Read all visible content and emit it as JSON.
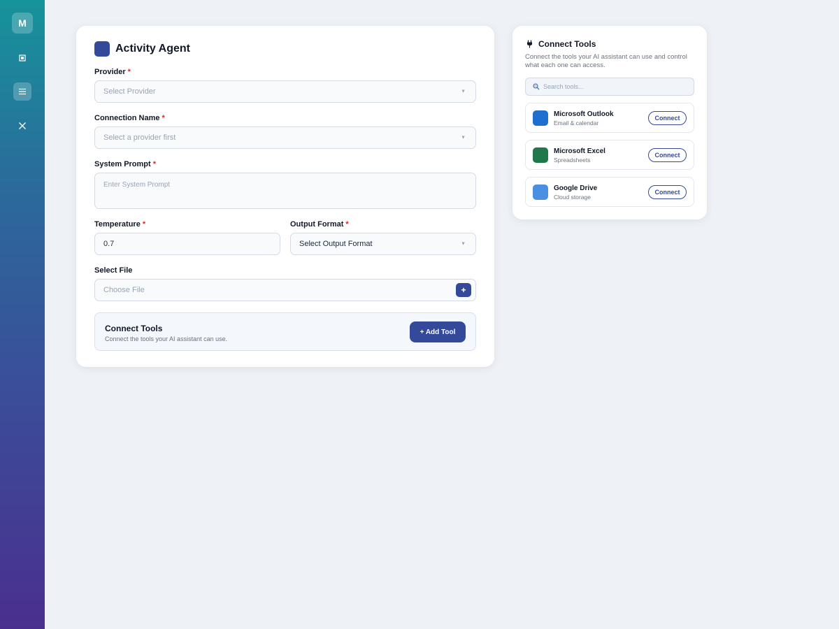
{
  "sidebar": {
    "logo_letter": "M",
    "items": [
      {
        "icon": "square-icon",
        "active": false
      },
      {
        "icon": "menu-icon",
        "active": true
      },
      {
        "icon": "close-icon",
        "active": false
      }
    ]
  },
  "form": {
    "title": "Activity Agent",
    "required_mark": "*",
    "provider": {
      "label": "Provider",
      "placeholder": "Select Provider"
    },
    "connection_name": {
      "label": "Connection Name",
      "placeholder": "Select a provider first"
    },
    "system_prompt": {
      "label": "System Prompt",
      "placeholder": "Enter System Prompt"
    },
    "temperature": {
      "label": "Temperature",
      "value": "0.7"
    },
    "output_format": {
      "label": "Output Format",
      "value": "Select Output Format"
    },
    "select_file": {
      "label": "Select File",
      "placeholder": "Choose File",
      "button": "+"
    },
    "connect_tools": {
      "title": "Connect Tools",
      "subtitle": "Connect the tools your AI assistant can use.",
      "button": "+ Add Tool"
    }
  },
  "panel": {
    "title": "Connect Tools",
    "description": "Connect the tools your AI assistant can use and control what each one can access.",
    "search_placeholder": "Search tools...",
    "tools": [
      {
        "name": "Microsoft Outlook",
        "subtitle": "Email & calendar",
        "button": "Connect",
        "color": "#1f6fd0"
      },
      {
        "name": "Microsoft Excel",
        "subtitle": "Spreadsheets",
        "button": "Connect",
        "color": "#21764a"
      },
      {
        "name": "Google Drive",
        "subtitle": "Cloud storage",
        "button": "Connect",
        "color": "#4a90e2"
      }
    ]
  },
  "colors": {
    "accent": "#34499a",
    "required": "#dc2626"
  }
}
